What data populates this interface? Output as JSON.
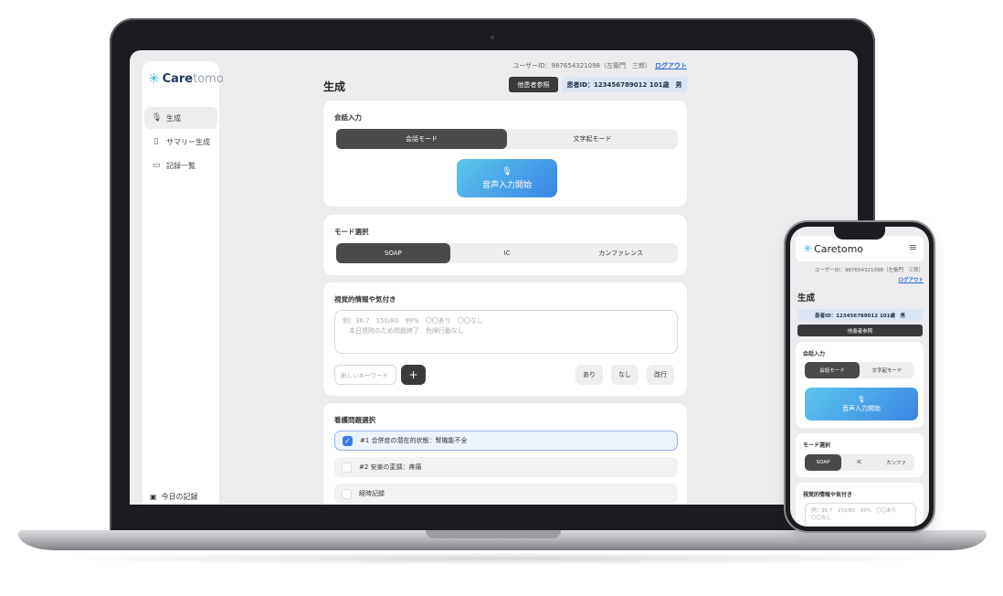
{
  "app": {
    "logo_main": "Care",
    "logo_sub": "tomo"
  },
  "sidebar": {
    "items": [
      {
        "label": "生成",
        "icon": "microphone-icon"
      },
      {
        "label": "サマリー生成",
        "icon": "clipboard-icon"
      },
      {
        "label": "記録一覧",
        "icon": "folder-icon"
      }
    ],
    "today_label": "今日の記録"
  },
  "header": {
    "user_info": "ユーザーID：987654321098（左衛門　三郎）",
    "logout": "ログアウト",
    "page_title": "生成",
    "other_patient_button": "他患者参照",
    "patient_id": "患者ID：123456789012  101歳　男"
  },
  "conversation": {
    "title": "会話入力",
    "modes": [
      "会話モード",
      "文字起モード"
    ],
    "active_mode": 0,
    "voice_button": "音声入力開始"
  },
  "mode_select": {
    "title": "モード選択",
    "options": [
      "SOAP",
      "IC",
      "カンファレンス"
    ],
    "active": 0
  },
  "visual_info": {
    "title": "視覚的情報や気付き",
    "placeholder": "例）36.7　150/80　99%　〇〇あり　〇〇なし\n　本日退院のため問題終了　危険行動なし",
    "keyword_placeholder": "新しいキーワード",
    "add_button": "+",
    "chips": [
      "あり",
      "なし",
      "改行"
    ]
  },
  "nursing_issues": {
    "title": "看護問題選択",
    "items": [
      {
        "label": "#1 合併症の潜在的状態：腎機能不全",
        "checked": true
      },
      {
        "label": "#2 安楽の変調：疼痛",
        "checked": false
      },
      {
        "label": "経時記録",
        "checked": false
      }
    ]
  },
  "mobile": {
    "user_info": "ユーザーID：987654321098（左衛門　三郎）",
    "logout": "ログアウト",
    "page_title": "生成",
    "patient_id": "患者ID：123456789012  101歳　男",
    "other_patient_button": "他患者参照",
    "conversation_title": "会話入力",
    "modes": [
      "会話モード",
      "文字起モード"
    ],
    "voice_button": "音声入力開始",
    "mode_select_title": "モード選択",
    "mode_options": [
      "SOAP",
      "IC",
      "カンファ"
    ],
    "visual_title": "視覚的情報や気付き",
    "visual_placeholder": "例）36.7　150/80　99%　〇〇あり\n〇〇なし"
  },
  "colors": {
    "accent_blue": "#3a85e4",
    "active_segment": "#4a4a4c",
    "patient_badge": "#dbe5f4"
  }
}
